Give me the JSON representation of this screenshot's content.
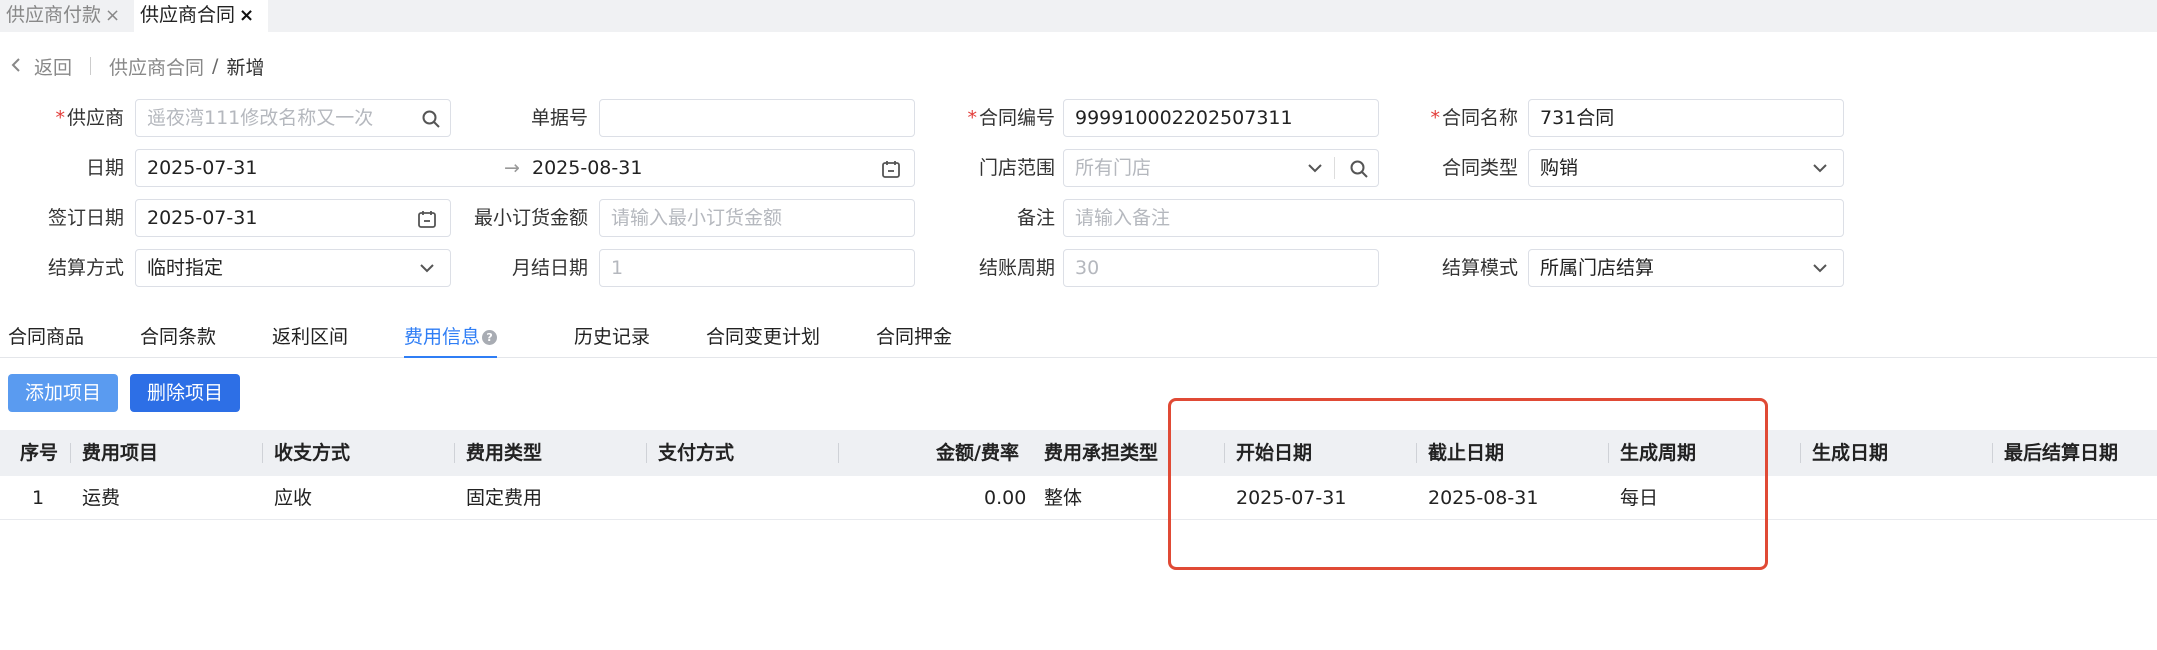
{
  "tabs": [
    {
      "label": "供应商付款",
      "close": "×"
    },
    {
      "label": "供应商合同",
      "close": "×"
    }
  ],
  "breadcrumb": {
    "back": "返回",
    "parent": "供应商合同",
    "separator": "/",
    "current": "新增"
  },
  "form": {
    "supplier": {
      "label": "供应商",
      "placeholder": "遥夜湾111修改名称又一次"
    },
    "doc_no": {
      "label": "单据号",
      "value": ""
    },
    "contract_no": {
      "label": "合同编号",
      "value": "999910002202507311"
    },
    "contract_name": {
      "label": "合同名称",
      "value": "731合同"
    },
    "date": {
      "label": "日期",
      "start": "2025-07-31",
      "arrow": "→",
      "end": "2025-08-31"
    },
    "store_range": {
      "label": "门店范围",
      "placeholder": "所有门店"
    },
    "contract_type": {
      "label": "合同类型",
      "value": "购销"
    },
    "sign_date": {
      "label": "签订日期",
      "value": "2025-07-31"
    },
    "min_order": {
      "label": "最小订货金额",
      "placeholder": "请输入最小订货金额"
    },
    "remark": {
      "label": "备注",
      "placeholder": "请输入备注"
    },
    "settle_method": {
      "label": "结算方式",
      "value": "临时指定"
    },
    "month_day": {
      "label": "月结日期",
      "placeholder": "1"
    },
    "settle_period": {
      "label": "结账周期",
      "placeholder": "30"
    },
    "settle_mode": {
      "label": "结算模式",
      "value": "所属门店结算"
    }
  },
  "subtabs": [
    "合同商品",
    "合同条款",
    "返利区间",
    "费用信息",
    "历史记录",
    "合同变更计划",
    "合同押金"
  ],
  "active_subtab_index": 3,
  "buttons": {
    "add": "添加项目",
    "delete": "删除项目"
  },
  "table": {
    "headers": [
      "序号",
      "费用项目",
      "收支方式",
      "费用类型",
      "支付方式",
      "金额/费率",
      "费用承担类型",
      "开始日期",
      "截止日期",
      "生成周期",
      "生成日期",
      "最后结算日期"
    ],
    "rows": [
      [
        "1",
        "运费",
        "应收",
        "固定费用",
        "",
        "0.00",
        "整体",
        "2025-07-31",
        "2025-08-31",
        "每日",
        "",
        ""
      ]
    ]
  },
  "colors": {
    "accent": "#2f7ef5",
    "required": "#e23c39",
    "highlight": "#e04a35"
  },
  "icons": [
    "search-icon",
    "calendar-icon",
    "chevron-down-icon",
    "close-icon",
    "chevron-left-icon",
    "help-icon"
  ]
}
